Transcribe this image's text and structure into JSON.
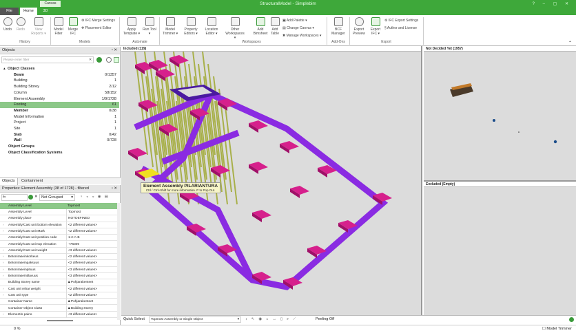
{
  "window": {
    "title": "StructuralModel - Simplebim",
    "context_tab": "Canvas"
  },
  "tabs": [
    "File",
    "Home",
    "3D"
  ],
  "ribbon": {
    "buttons": [
      {
        "id": "undo",
        "label": "Undo"
      },
      {
        "id": "redo",
        "label": "Redo"
      },
      {
        "id": "view-reports",
        "label": "View Reports ▾"
      },
      {
        "id": "model-filter",
        "label": "Model Filter"
      },
      {
        "id": "merge-ifc",
        "label": "Merge IFC"
      },
      {
        "id": "apply-template",
        "label": "Apply Template ▾"
      },
      {
        "id": "run-tool",
        "label": "Run Tool ▾"
      },
      {
        "id": "model-trimmer",
        "label": "Model Trimmer ▾"
      },
      {
        "id": "property-editors",
        "label": "Property Editors ▾"
      },
      {
        "id": "location-editors",
        "label": "Location Editor ▾"
      },
      {
        "id": "other-workspaces",
        "label": "Other Workspaces ▾"
      },
      {
        "id": "add-bimsheet",
        "label": "Add Bimsheet"
      },
      {
        "id": "add-table",
        "label": "Add Table"
      },
      {
        "id": "bcf-manager",
        "label": "BCF Manager"
      },
      {
        "id": "export-preview",
        "label": "Export Preview"
      },
      {
        "id": "export-ifc",
        "label": "Export IFC ▾"
      }
    ],
    "small": {
      "ifc_merge_settings": "IFC Merge Settings",
      "placement_editor": "Placement Editor",
      "add_palette": "Add Palette ▾",
      "change_canvas": "Change Canvas ▾",
      "manage_workspaces": "Manage Workspaces ▾",
      "ifc_export_settings": "IFC Export Settings",
      "author_license": "Author and License"
    },
    "groups": {
      "history": "History",
      "models": "Models",
      "automate": "Automate",
      "workspaces": "Workspaces",
      "addons": "Add-Ons",
      "export": "Export"
    }
  },
  "objects": {
    "title": "Objects",
    "filter_placeholder": "Please enter filter",
    "tree": [
      {
        "label": "Object Classes",
        "count": "",
        "bold": true,
        "level": 0
      },
      {
        "label": "Beam",
        "count": "0/1357",
        "bold": true,
        "level": 1
      },
      {
        "label": "Building",
        "count": "1",
        "level": 1
      },
      {
        "label": "Building Storey",
        "count": "2/12",
        "level": 1
      },
      {
        "label": "Column",
        "count": "58/152",
        "level": 1
      },
      {
        "label": "Element Assembly",
        "count": "1/9/1728",
        "level": 1
      },
      {
        "label": "Footing",
        "count": "61",
        "level": 1,
        "selected": true
      },
      {
        "label": "Member",
        "count": "0/38",
        "bold": true,
        "level": 1
      },
      {
        "label": "Model Information",
        "count": "1",
        "level": 1
      },
      {
        "label": "Project",
        "count": "1",
        "level": 1
      },
      {
        "label": "Site",
        "count": "1",
        "level": 1
      },
      {
        "label": "Slab",
        "count": "0/42",
        "bold": true,
        "level": 1
      },
      {
        "label": "Wall",
        "count": "0/728",
        "bold": true,
        "level": 1
      },
      {
        "label": "Object Groups",
        "count": "",
        "bold": true,
        "level": 0
      },
      {
        "label": "Object Classification Systems",
        "count": "",
        "bold": true,
        "level": 0
      }
    ],
    "bottom_tabs": [
      "Objects",
      "Containment"
    ]
  },
  "properties": {
    "title": "Properties: Element Assembly (38 of 1728) - filtered",
    "grouping": "Not Grouped",
    "header": [
      "Assembly Level",
      "Topmost"
    ],
    "rows": [
      [
        "Assembly Level",
        "Topmost"
      ],
      [
        "Assembly place",
        "NOTDEFINED"
      ],
      [
        "Assembly/Cast unit bottom elevation",
        "<2 different values>"
      ],
      [
        "Assembly/Cast unit Mark",
        "<2 different values>"
      ],
      [
        "Assembly/Cast unit position code",
        "1-2-A-B"
      ],
      [
        "Assembly/Cast unit top elevation",
        "+76300"
      ],
      [
        "Assembly/Cast unit weight",
        "<3 different values>"
      ],
      [
        "Betoniraseinkorkeus",
        "<2 different values>"
      ],
      [
        "Betoniraseinpaksuus",
        "<2 different values>"
      ],
      [
        "Betoniraseinpituus",
        "<3 different values>"
      ],
      [
        "Betoniraseintilavuus",
        "<3 different values>"
      ],
      [
        "Building Storey name",
        "Pohjarakenteet"
      ],
      [
        "Cast unit rebar weight",
        "<2 different values>"
      ],
      [
        "Cast unit type",
        "<2 different values>"
      ],
      [
        "Container Name",
        "Pohjarakenteet"
      ],
      [
        "Container Object Class",
        "Building Storey"
      ],
      [
        "Elementin paino",
        "<3 different values>"
      ]
    ]
  },
  "viewport": {
    "included": "Included (119)",
    "not_decided": "Not Decided Yet (1957)",
    "excluded": "Excluded (Empty)",
    "tooltip_title": "Element Assembly  PILARIANTURA",
    "tooltip_hint": "Ctrl / Ctrl+Shift for more information. P to Pop Out."
  },
  "quick_select": {
    "label": "Quick Select",
    "value": "Topmost Assembly or Single Object",
    "peeling": "Peeling Off"
  },
  "status": {
    "progress": "0 %",
    "model_trimmer": "Model Trimmer"
  },
  "colors": {
    "brand": "#3ea83a",
    "beam": "#8a2be2",
    "footing": "#d6208c",
    "column": "#a8b04a",
    "selected": "#8cc888"
  }
}
